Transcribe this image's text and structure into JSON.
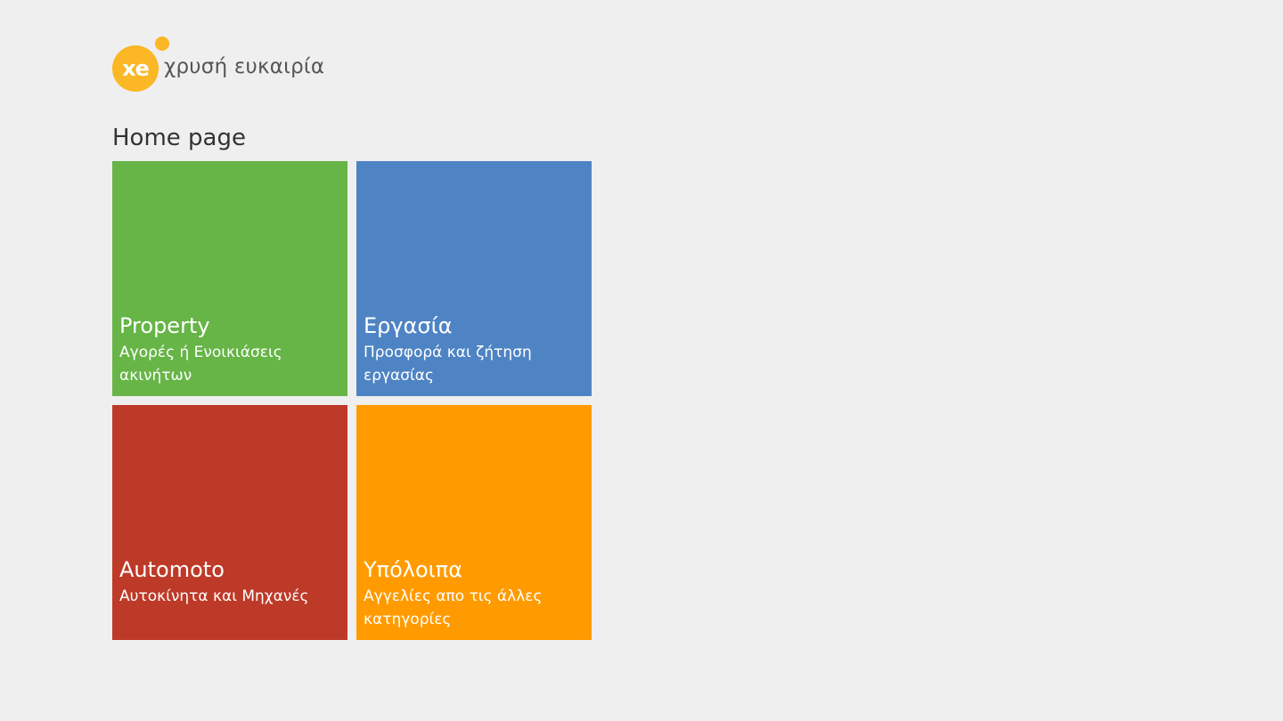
{
  "header": {
    "logo_mark": "xe",
    "logo_text": "χρυσή ευκαιρία",
    "brand_color": "#fbb725"
  },
  "page": {
    "title": "Home page",
    "background": "#efefef"
  },
  "tiles": [
    {
      "title": "Property",
      "subtitle": "Αγορές ή Ενοικιάσεις ακινήτων",
      "color": "#66b546"
    },
    {
      "title": "Εργασία",
      "subtitle": "Προσφορά και ζήτηση εργασίας",
      "color": "#4f84c4"
    },
    {
      "title": "Automoto",
      "subtitle": "Αυτοκίνητα και Μηχανές",
      "color": "#be3a28"
    },
    {
      "title": "Υπόλοιπα",
      "subtitle": "Αγγελίες απο τις άλλες κατηγορίες",
      "color": "#ff9b00"
    }
  ]
}
